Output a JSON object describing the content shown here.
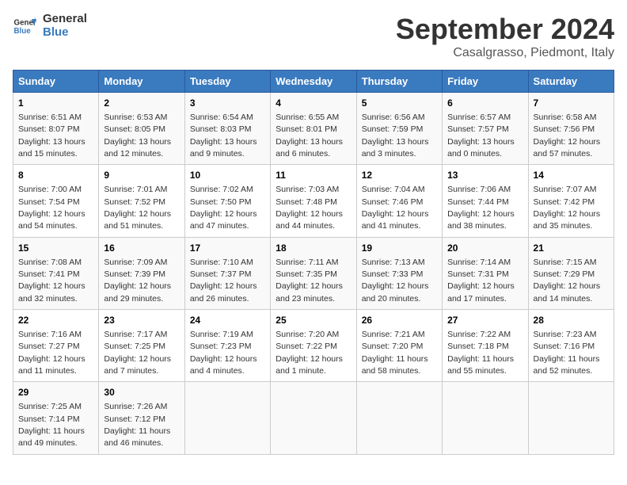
{
  "header": {
    "logo_line1": "General",
    "logo_line2": "Blue",
    "month_title": "September 2024",
    "location": "Casalgrasso, Piedmont, Italy"
  },
  "days_of_week": [
    "Sunday",
    "Monday",
    "Tuesday",
    "Wednesday",
    "Thursday",
    "Friday",
    "Saturday"
  ],
  "weeks": [
    [
      {
        "day": "1",
        "info": "Sunrise: 6:51 AM\nSunset: 8:07 PM\nDaylight: 13 hours\nand 15 minutes."
      },
      {
        "day": "2",
        "info": "Sunrise: 6:53 AM\nSunset: 8:05 PM\nDaylight: 13 hours\nand 12 minutes."
      },
      {
        "day": "3",
        "info": "Sunrise: 6:54 AM\nSunset: 8:03 PM\nDaylight: 13 hours\nand 9 minutes."
      },
      {
        "day": "4",
        "info": "Sunrise: 6:55 AM\nSunset: 8:01 PM\nDaylight: 13 hours\nand 6 minutes."
      },
      {
        "day": "5",
        "info": "Sunrise: 6:56 AM\nSunset: 7:59 PM\nDaylight: 13 hours\nand 3 minutes."
      },
      {
        "day": "6",
        "info": "Sunrise: 6:57 AM\nSunset: 7:57 PM\nDaylight: 13 hours\nand 0 minutes."
      },
      {
        "day": "7",
        "info": "Sunrise: 6:58 AM\nSunset: 7:56 PM\nDaylight: 12 hours\nand 57 minutes."
      }
    ],
    [
      {
        "day": "8",
        "info": "Sunrise: 7:00 AM\nSunset: 7:54 PM\nDaylight: 12 hours\nand 54 minutes."
      },
      {
        "day": "9",
        "info": "Sunrise: 7:01 AM\nSunset: 7:52 PM\nDaylight: 12 hours\nand 51 minutes."
      },
      {
        "day": "10",
        "info": "Sunrise: 7:02 AM\nSunset: 7:50 PM\nDaylight: 12 hours\nand 47 minutes."
      },
      {
        "day": "11",
        "info": "Sunrise: 7:03 AM\nSunset: 7:48 PM\nDaylight: 12 hours\nand 44 minutes."
      },
      {
        "day": "12",
        "info": "Sunrise: 7:04 AM\nSunset: 7:46 PM\nDaylight: 12 hours\nand 41 minutes."
      },
      {
        "day": "13",
        "info": "Sunrise: 7:06 AM\nSunset: 7:44 PM\nDaylight: 12 hours\nand 38 minutes."
      },
      {
        "day": "14",
        "info": "Sunrise: 7:07 AM\nSunset: 7:42 PM\nDaylight: 12 hours\nand 35 minutes."
      }
    ],
    [
      {
        "day": "15",
        "info": "Sunrise: 7:08 AM\nSunset: 7:41 PM\nDaylight: 12 hours\nand 32 minutes."
      },
      {
        "day": "16",
        "info": "Sunrise: 7:09 AM\nSunset: 7:39 PM\nDaylight: 12 hours\nand 29 minutes."
      },
      {
        "day": "17",
        "info": "Sunrise: 7:10 AM\nSunset: 7:37 PM\nDaylight: 12 hours\nand 26 minutes."
      },
      {
        "day": "18",
        "info": "Sunrise: 7:11 AM\nSunset: 7:35 PM\nDaylight: 12 hours\nand 23 minutes."
      },
      {
        "day": "19",
        "info": "Sunrise: 7:13 AM\nSunset: 7:33 PM\nDaylight: 12 hours\nand 20 minutes."
      },
      {
        "day": "20",
        "info": "Sunrise: 7:14 AM\nSunset: 7:31 PM\nDaylight: 12 hours\nand 17 minutes."
      },
      {
        "day": "21",
        "info": "Sunrise: 7:15 AM\nSunset: 7:29 PM\nDaylight: 12 hours\nand 14 minutes."
      }
    ],
    [
      {
        "day": "22",
        "info": "Sunrise: 7:16 AM\nSunset: 7:27 PM\nDaylight: 12 hours\nand 11 minutes."
      },
      {
        "day": "23",
        "info": "Sunrise: 7:17 AM\nSunset: 7:25 PM\nDaylight: 12 hours\nand 7 minutes."
      },
      {
        "day": "24",
        "info": "Sunrise: 7:19 AM\nSunset: 7:23 PM\nDaylight: 12 hours\nand 4 minutes."
      },
      {
        "day": "25",
        "info": "Sunrise: 7:20 AM\nSunset: 7:22 PM\nDaylight: 12 hours\nand 1 minute."
      },
      {
        "day": "26",
        "info": "Sunrise: 7:21 AM\nSunset: 7:20 PM\nDaylight: 11 hours\nand 58 minutes."
      },
      {
        "day": "27",
        "info": "Sunrise: 7:22 AM\nSunset: 7:18 PM\nDaylight: 11 hours\nand 55 minutes."
      },
      {
        "day": "28",
        "info": "Sunrise: 7:23 AM\nSunset: 7:16 PM\nDaylight: 11 hours\nand 52 minutes."
      }
    ],
    [
      {
        "day": "29",
        "info": "Sunrise: 7:25 AM\nSunset: 7:14 PM\nDaylight: 11 hours\nand 49 minutes."
      },
      {
        "day": "30",
        "info": "Sunrise: 7:26 AM\nSunset: 7:12 PM\nDaylight: 11 hours\nand 46 minutes."
      },
      {
        "day": "",
        "info": ""
      },
      {
        "day": "",
        "info": ""
      },
      {
        "day": "",
        "info": ""
      },
      {
        "day": "",
        "info": ""
      },
      {
        "day": "",
        "info": ""
      }
    ]
  ]
}
